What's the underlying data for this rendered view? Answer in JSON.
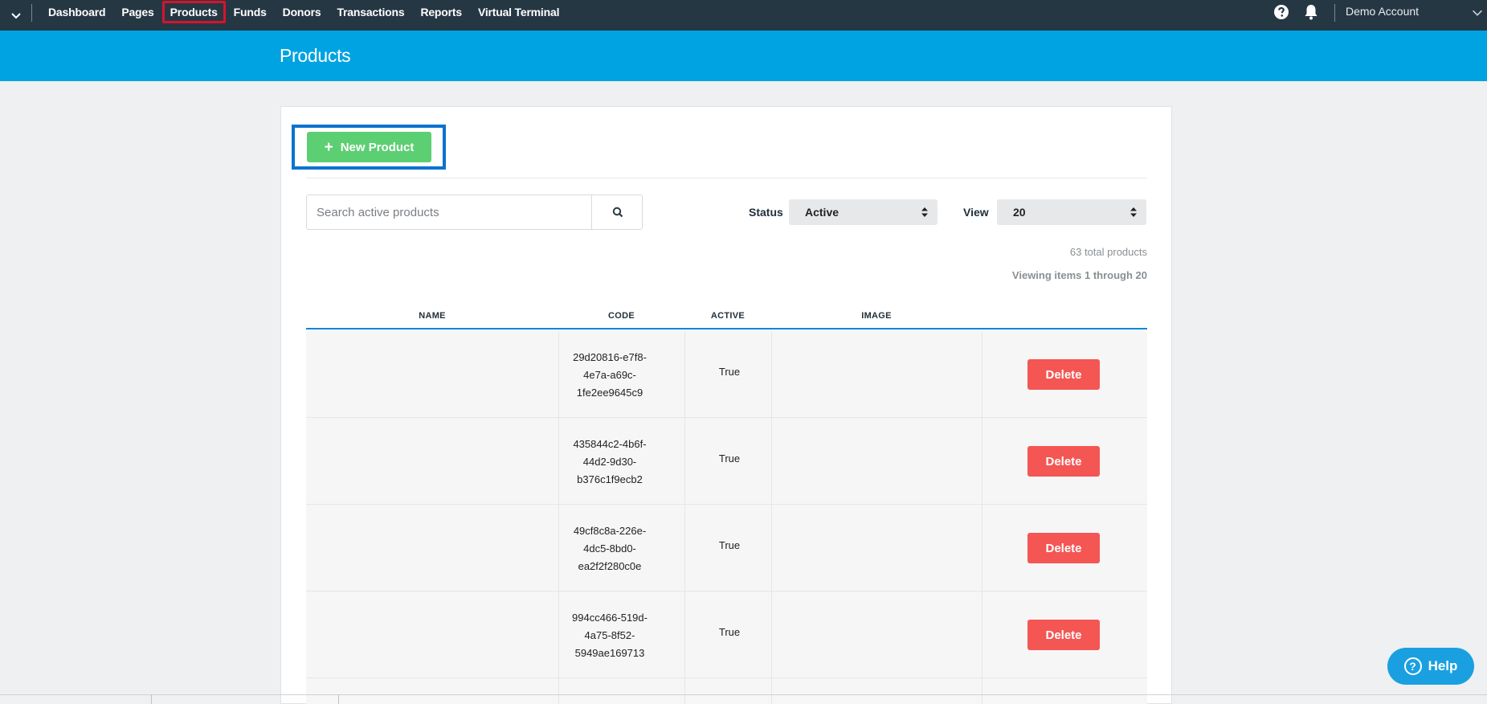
{
  "nav": {
    "items": [
      {
        "label": "Dashboard"
      },
      {
        "label": "Pages"
      },
      {
        "label": "Products",
        "selected": true
      },
      {
        "label": "Funds"
      },
      {
        "label": "Donors"
      },
      {
        "label": "Transactions"
      },
      {
        "label": "Reports"
      },
      {
        "label": "Virtual Terminal"
      }
    ],
    "account": "Demo Account",
    "icons": [
      "chevron-down-icon",
      "help-circle-icon",
      "bell-icon"
    ]
  },
  "header": {
    "title": "Products"
  },
  "toolbar": {
    "new_product_label": "New Product"
  },
  "search": {
    "placeholder": "Search active products"
  },
  "filters": {
    "status_label": "Status",
    "status_value": "Active",
    "view_label": "View",
    "view_value": "20"
  },
  "summary": {
    "total": "63 total products",
    "viewing": "Viewing items 1 through 20"
  },
  "table": {
    "headers": {
      "name": "NAME",
      "code": "CODE",
      "active": "ACTIVE",
      "image": "IMAGE"
    },
    "rows": [
      {
        "name": "",
        "code": [
          "29d20816-e7f8-",
          "4e7a-a69c-",
          "1fe2ee9645c9"
        ],
        "active": "True",
        "delete_label": "Delete"
      },
      {
        "name": "",
        "code": [
          "435844c2-4b6f-",
          "44d2-9d30-",
          "b376c1f9ecb2"
        ],
        "active": "True",
        "delete_label": "Delete"
      },
      {
        "name": "",
        "code": [
          "49cf8c8a-226e-",
          "4dc5-8bd0-",
          "ea2f2f280c0e"
        ],
        "active": "True",
        "delete_label": "Delete"
      },
      {
        "name": "",
        "code": [
          "994cc466-519d-",
          "4a75-8f52-",
          "5949ae169713"
        ],
        "active": "True",
        "delete_label": "Delete"
      }
    ]
  },
  "help": {
    "label": "Help"
  },
  "colors": {
    "nav_bg": "#263744",
    "header_bg": "#00a3e1",
    "new_button": "#5ccf73",
    "delete_button": "#f45653",
    "selected_outline": "#d8132b",
    "highlight_outline": "#0b72d0"
  }
}
